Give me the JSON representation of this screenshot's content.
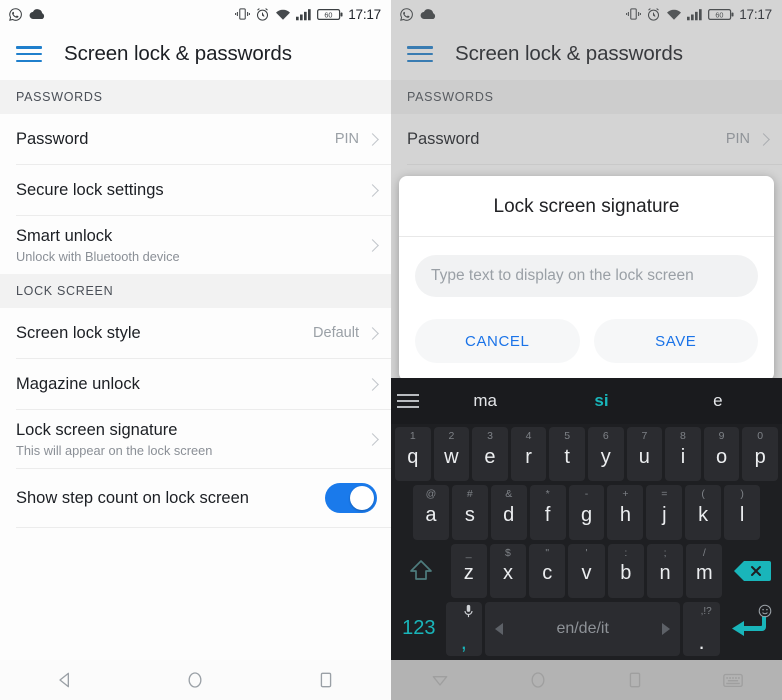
{
  "status_bar": {
    "time": "17:17",
    "battery_level": "60",
    "icons": [
      "whatsapp-icon",
      "cloud-icon",
      "vibrate-icon",
      "alarm-icon",
      "wifi-icon",
      "signal-icon",
      "battery-icon"
    ]
  },
  "app_bar": {
    "title": "Screen lock & passwords",
    "menu_icon": "hamburger-menu-icon"
  },
  "sections": [
    {
      "header": "PASSWORDS",
      "rows": [
        {
          "title": "Password",
          "sub": "",
          "value": "PIN",
          "accessory": "chevron"
        },
        {
          "title": "Secure lock settings",
          "sub": "",
          "value": "",
          "accessory": "chevron"
        },
        {
          "title": "Smart unlock",
          "sub": "Unlock with Bluetooth device",
          "value": "",
          "accessory": "chevron"
        }
      ]
    },
    {
      "header": "LOCK SCREEN",
      "rows": [
        {
          "title": "Screen lock style",
          "sub": "",
          "value": "Default",
          "accessory": "chevron"
        },
        {
          "title": "Magazine unlock",
          "sub": "",
          "value": "",
          "accessory": "chevron"
        },
        {
          "title": "Lock screen signature",
          "sub": "This will appear on the lock screen",
          "value": "",
          "accessory": "chevron"
        },
        {
          "title": "Show step count on lock screen",
          "sub": "",
          "value": "",
          "accessory": "toggle",
          "toggle_on": true
        }
      ]
    }
  ],
  "dialog": {
    "title": "Lock screen signature",
    "input_value": "",
    "input_placeholder": "Type text to display on the lock screen",
    "cancel_label": "CANCEL",
    "save_label": "SAVE"
  },
  "keyboard": {
    "suggestions": [
      {
        "text": "ma",
        "active": false
      },
      {
        "text": "si",
        "active": true
      },
      {
        "text": "e",
        "active": false
      }
    ],
    "menu_icon": "keyboard-menu-icon",
    "row1": [
      {
        "main": "q",
        "alt": "1"
      },
      {
        "main": "w",
        "alt": "2"
      },
      {
        "main": "e",
        "alt": "3"
      },
      {
        "main": "r",
        "alt": "4"
      },
      {
        "main": "t",
        "alt": "5"
      },
      {
        "main": "y",
        "alt": "6"
      },
      {
        "main": "u",
        "alt": "7"
      },
      {
        "main": "i",
        "alt": "8"
      },
      {
        "main": "o",
        "alt": "9"
      },
      {
        "main": "p",
        "alt": "0"
      }
    ],
    "row2": [
      {
        "main": "a",
        "alt": "@"
      },
      {
        "main": "s",
        "alt": "#"
      },
      {
        "main": "d",
        "alt": "&"
      },
      {
        "main": "f",
        "alt": "*"
      },
      {
        "main": "g",
        "alt": "-"
      },
      {
        "main": "h",
        "alt": "+"
      },
      {
        "main": "j",
        "alt": "="
      },
      {
        "main": "k",
        "alt": "("
      },
      {
        "main": "l",
        "alt": ")"
      }
    ],
    "row3": [
      {
        "main": "z",
        "alt": "_"
      },
      {
        "main": "x",
        "alt": "$"
      },
      {
        "main": "c",
        "alt": "\""
      },
      {
        "main": "v",
        "alt": "'"
      },
      {
        "main": "b",
        "alt": ":"
      },
      {
        "main": "n",
        "alt": ";"
      },
      {
        "main": "m",
        "alt": "/"
      }
    ],
    "shift_icon": "shift-arrow-icon",
    "backspace_icon": "backspace-icon",
    "numeric_label": "123",
    "comma_label": ",",
    "mic_icon": "microphone-icon",
    "space_label": "en/de/it",
    "period_label": ".",
    "period_alt": ",!?",
    "emoji_icon": "smiley-icon",
    "enter_icon": "enter-arrow-icon"
  },
  "nav_bar_left": {
    "back_icon": "back-triangle-icon",
    "home_icon": "home-circle-icon",
    "recents_icon": "recents-square-icon"
  },
  "nav_bar_right": {
    "dismiss_icon": "keyboard-dismiss-triangle-icon",
    "home_icon": "home-circle-icon",
    "recents_icon": "recents-square-icon",
    "keyboard_icon": "keyboard-switch-icon"
  },
  "colors": {
    "accent_blue": "#1a73e8",
    "toggle_on": "#1a7aeb",
    "keyboard_accent": "#19b5ba",
    "keyboard_bg": "#1e1f22"
  }
}
